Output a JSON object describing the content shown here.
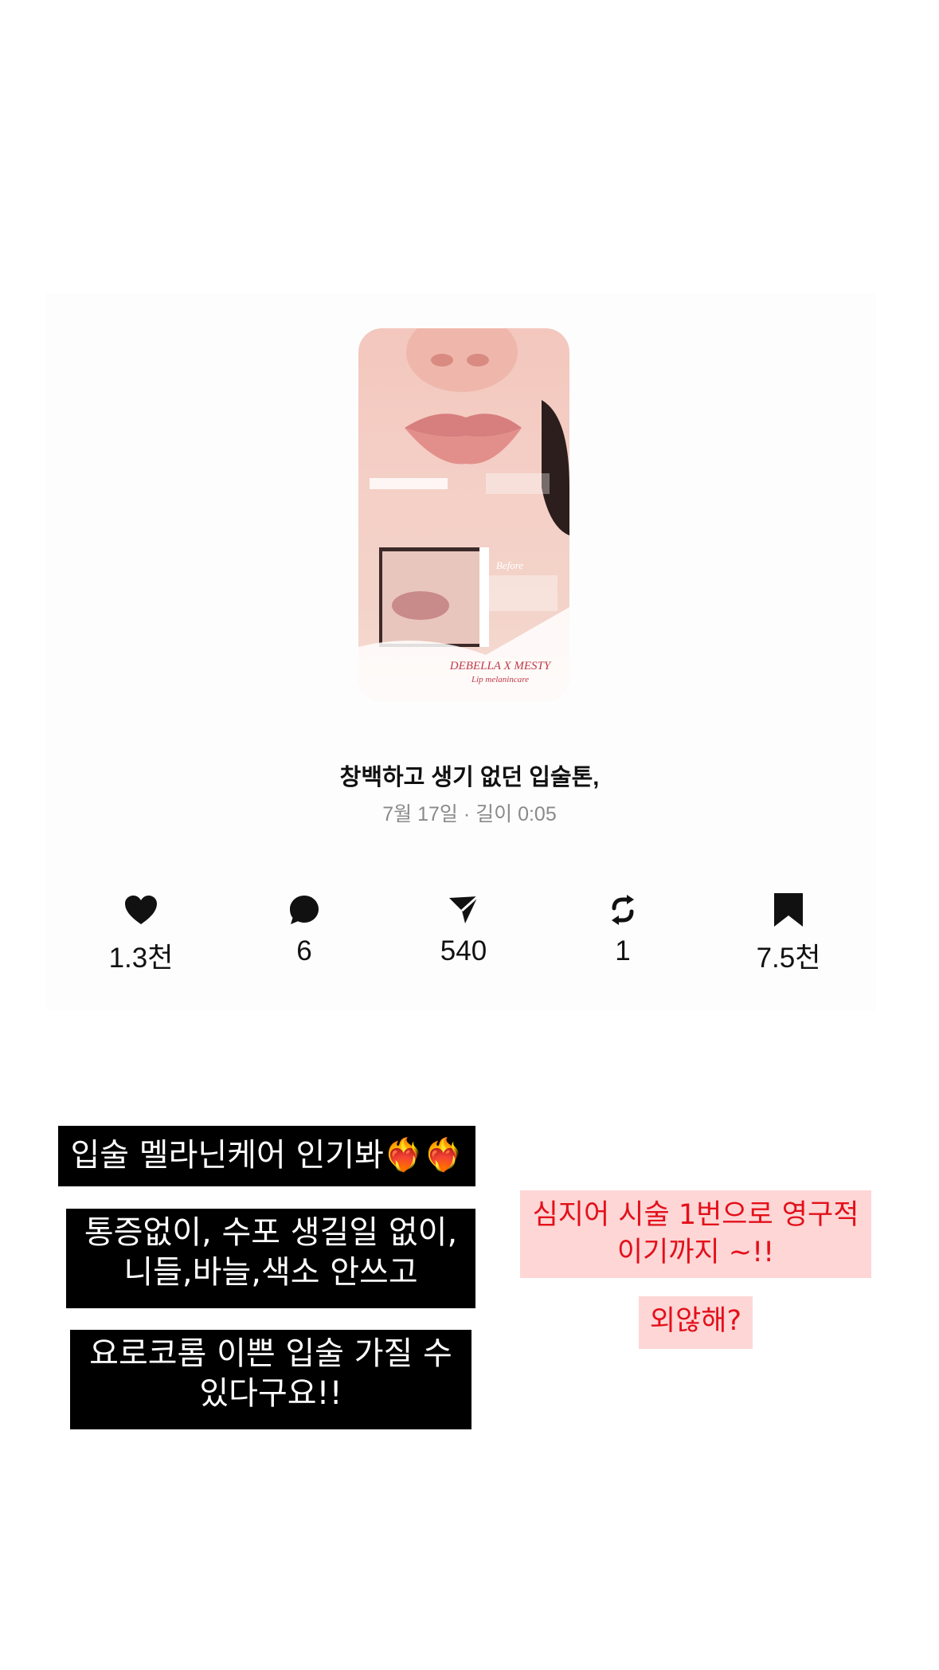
{
  "post": {
    "title": "창백하고 생기 없던 입술톤,",
    "meta": "7월 17일 · 길이 0:05",
    "thumbnail": {
      "brand_line1": "DEBELLA X MESTY",
      "brand_line2": "Lip melanincare",
      "before_label": "Before"
    }
  },
  "stats": [
    {
      "icon": "heart-icon",
      "value": "1.3천"
    },
    {
      "icon": "comment-icon",
      "value": "6"
    },
    {
      "icon": "send-icon",
      "value": "540"
    },
    {
      "icon": "repost-icon",
      "value": "1"
    },
    {
      "icon": "bookmark-icon",
      "value": "7.5천"
    }
  ],
  "captions_left": [
    {
      "text": "입술 멜라닌케어 인기봐❤️‍🔥❤️‍🔥"
    },
    {
      "line1": "통증없이, 수포 생길일 없이,",
      "line2": "니들,바늘,색소 안쓰고"
    },
    {
      "line1": "요로코롬 이쁜 입술 가질 수",
      "line2": "있다구요!!"
    }
  ],
  "captions_right": [
    {
      "line1": "심지어 시술 1번으로 영구적",
      "line2": "이기까지 ~!!"
    },
    {
      "text": "외않해?"
    }
  ],
  "colors": {
    "caption_bg": "#000000",
    "pink_box_bg": "#fed6d6",
    "pink_text": "#e3101a"
  }
}
